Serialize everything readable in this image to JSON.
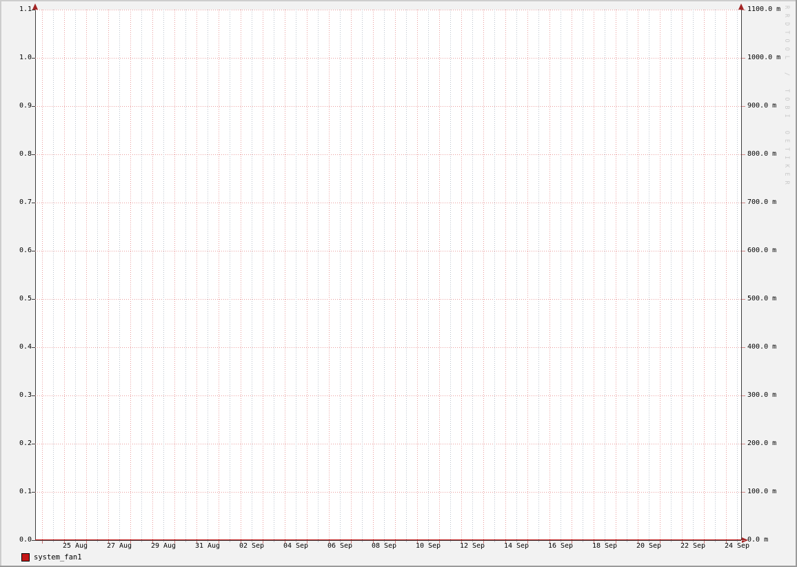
{
  "chart_data": {
    "type": "line",
    "title": "",
    "x_axis": {
      "tick_labels": [
        "25 Aug",
        "27 Aug",
        "29 Aug",
        "31 Aug",
        "02 Sep",
        "04 Sep",
        "06 Sep",
        "08 Sep",
        "10 Sep",
        "12 Sep",
        "14 Sep",
        "16 Sep",
        "18 Sep",
        "20 Sep",
        "22 Sep",
        "24 Sep"
      ],
      "range_description": "approx 1 month, late Aug to 24 Sep",
      "major_gridline_every": "1 day",
      "minor_gridline_every": "12 hours",
      "label_every": "2 days"
    },
    "y_axis_left": {
      "tick_labels": [
        "1.1",
        "1.0",
        "0.9",
        "0.8",
        "0.7",
        "0.6",
        "0.5",
        "0.4",
        "0.3",
        "0.2",
        "0.1",
        "0.0"
      ],
      "range": [
        0.0,
        1.1
      ],
      "tick_step": 0.1
    },
    "y_axis_right": {
      "tick_labels": [
        "1100.0 m",
        "1000.0 m",
        "900.0 m",
        "800.0 m",
        "700.0 m",
        "600.0 m",
        "500.0 m",
        "400.0 m",
        "300.0 m",
        "200.0 m",
        "100.0 m",
        "0.0 m"
      ],
      "range_milli": [
        0,
        1100
      ],
      "tick_step_milli": 100
    },
    "series": [
      {
        "name": "system_fan1",
        "color": "#c41818",
        "constant_value": 0,
        "values_description": "flat line at 0 across the entire time range (drawn along the x-axis)"
      }
    ],
    "legend": [
      {
        "label": "system_fan1",
        "swatch_color": "#c41818"
      }
    ],
    "grid": true,
    "legend_position": "bottom-left"
  },
  "watermark": "RRDTOOL / TOBI OETIKER",
  "colors": {
    "background": "#f2f2f2",
    "canvas": "#ffffff",
    "major_grid": "#e99a9a",
    "minor_grid": "#b9c0ca",
    "axis": "#3c3c3c",
    "arrow": "#a32424",
    "series_red": "#c41818",
    "border_light": "#cdcdcd",
    "border_dark": "#9a9a9a",
    "watermark_text": "#c9c9c9"
  }
}
